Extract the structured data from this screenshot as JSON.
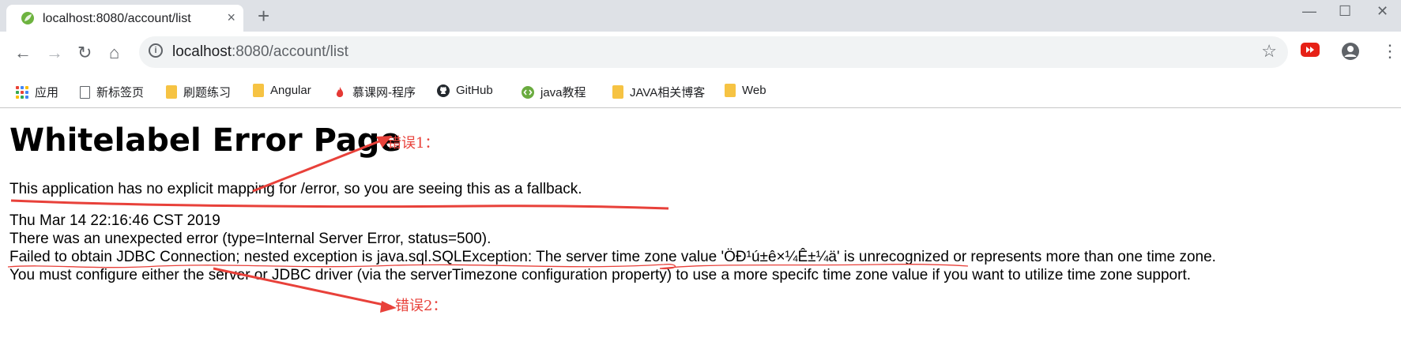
{
  "tab": {
    "title": "localhost:8080/account/list",
    "close": "×",
    "new_tab": "+"
  },
  "window_controls": {
    "minimize": "—",
    "maximize": "☐",
    "close": "✕"
  },
  "toolbar": {
    "back": "←",
    "forward": "→",
    "reload": "↻",
    "home": "⌂",
    "url_host": "localhost",
    "url_rest": ":8080/account/list",
    "star": "☆",
    "menu": "⋮"
  },
  "bookmarks": [
    {
      "label": "应用",
      "icon": "apps-grid-icon"
    },
    {
      "label": "新标签页",
      "icon": "page-icon"
    },
    {
      "label": "刷题练习",
      "icon": "folder-icon"
    },
    {
      "label": "Angular",
      "icon": "folder-icon"
    },
    {
      "label": "慕课网-程序",
      "icon": "flame-icon"
    },
    {
      "label": "GitHub",
      "icon": "github-icon"
    },
    {
      "label": "java教程",
      "icon": "code-icon"
    },
    {
      "label": "JAVA相关博客",
      "icon": "folder-icon"
    },
    {
      "label": "Web",
      "icon": "folder-icon"
    }
  ],
  "page": {
    "title": "Whitelabel Error Page",
    "line1": "This application has no explicit mapping for /error, so you are seeing this as a fallback.",
    "timestamp": "Thu Mar 14 22:16:46 CST 2019",
    "line2": "There was an unexpected error (type=Internal Server Error, status=500).",
    "line3": "Failed to obtain JDBC Connection; nested exception is java.sql.SQLException: The server time zone value 'ÖÐ¹ú±ê×¼Ê±¼ä' is unrecognized or represents more than one time zone.",
    "line4": "You must configure either the server or JDBC driver (via the serverTimezone configuration property) to use a more specifc time zone value if you want to utilize time zone support."
  },
  "annotations": {
    "error1": "错误1：",
    "error2": "错误2："
  },
  "colors": {
    "annotation": "#e8413a",
    "tabbar": "#dee1e6",
    "omnibox": "#f1f3f4"
  }
}
